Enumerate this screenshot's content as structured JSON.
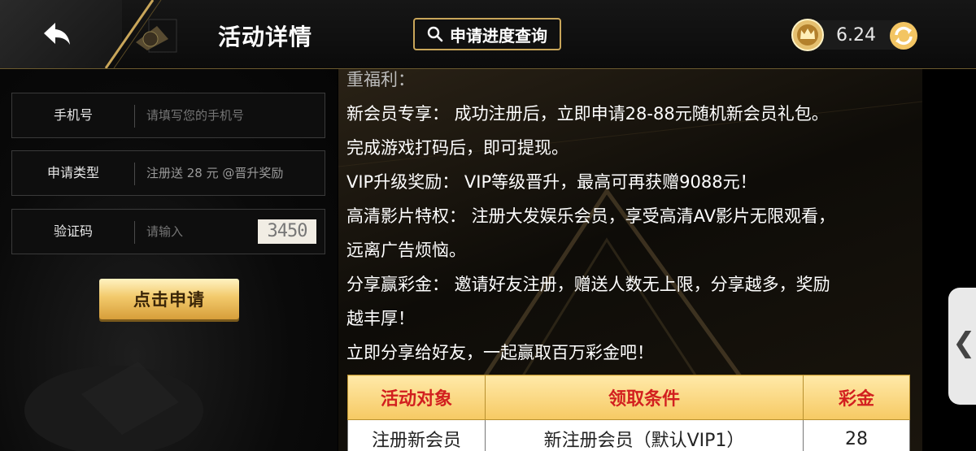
{
  "header": {
    "title": "活动详情",
    "query_button": "申请进度查询",
    "balance": "6.24"
  },
  "form": {
    "phone_label": "手机号",
    "phone_placeholder": "请填写您的手机号",
    "type_label": "申请类型",
    "type_value": "注册送 28 元 @晋升奖励",
    "code_label": "验证码",
    "code_placeholder": "请输入",
    "captcha": "3450",
    "submit": "点击申请"
  },
  "content": {
    "lines": [
      "重福利：",
      "新会员专享：  成功注册后，立即申请28-88元随机新会员礼包。",
      "完成游戏打码后，即可提现。",
      "VIP升级奖励：  VIP等级晋升，最高可再获赠9088元！",
      "高清影片特权：  注册大发娱乐会员，享受高清AV影片无限观看，",
      "远离广告烦恼。",
      "分享赢彩金：  邀请好友注册，赠送人数无上限，分享越多，奖励",
      "越丰厚！",
      "立即分享给好友，一起赢取百万彩金吧！"
    ],
    "table": {
      "headers": [
        "活动对象",
        "领取条件",
        "彩金"
      ],
      "rows": [
        [
          "注册新会员",
          "新注册会员（默认VIP1）",
          "28"
        ]
      ]
    }
  },
  "side_tab": "❮"
}
